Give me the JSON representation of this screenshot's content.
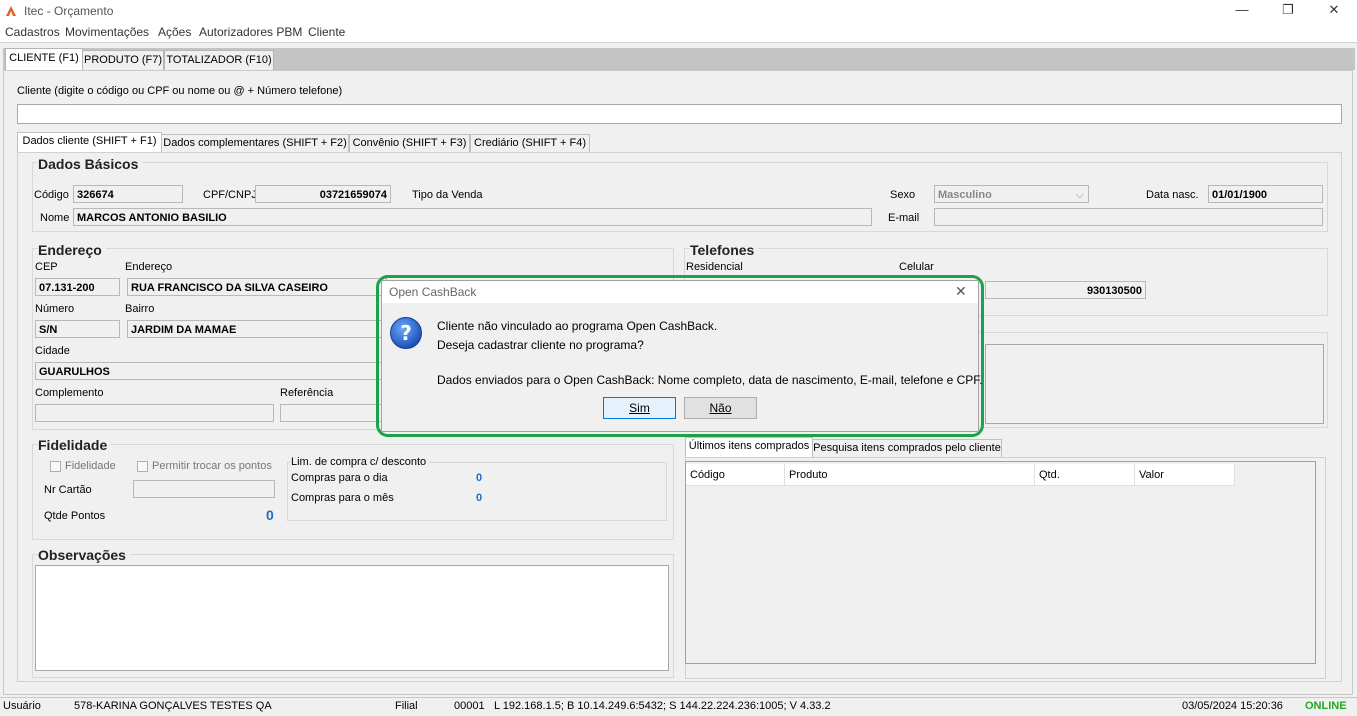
{
  "window": {
    "title": "Itec - Orçamento",
    "minimize": "—",
    "maximize": "❐",
    "close": "✕"
  },
  "menu": [
    "Cadastros",
    "Movimentações",
    "Ações",
    "Autorizadores PBM",
    "Cliente"
  ],
  "main_tabs": [
    "CLIENTE (F1)",
    "PRODUTO (F7)",
    "TOTALIZADOR (F10)"
  ],
  "client_search": {
    "label": "Cliente (digite o código ou CPF ou nome ou @ + Número telefone)",
    "value": ""
  },
  "sub_tabs": [
    "Dados cliente (SHIFT + F1)",
    "Dados complementares (SHIFT + F2)",
    "Convênio (SHIFT + F3)",
    "Crediário (SHIFT + F4)"
  ],
  "basic": {
    "title": "Dados Básicos",
    "codigo_label": "Código",
    "codigo": "326674",
    "cpf_label": "CPF/CNPJ",
    "cpf": "03721659074",
    "tipo_venda_label": "Tipo da Venda",
    "sexo_label": "Sexo",
    "sexo": "Masculino",
    "nasc_label": "Data nasc.",
    "nasc": "01/01/1900",
    "nome_label": "Nome",
    "nome": "MARCOS ANTONIO BASILIO",
    "email_label": "E-mail",
    "email": ""
  },
  "address": {
    "title": "Endereço",
    "cep_label": "CEP",
    "cep": "07.131-200",
    "endereco_label": "Endereço",
    "endereco": "RUA FRANCISCO DA SILVA CASEIRO",
    "numero_label": "Número",
    "numero": "S/N",
    "bairro_label": "Bairro",
    "bairro": "JARDIM DA MAMAE",
    "cidade_label": "Cidade",
    "cidade": "GUARULHOS",
    "complemento_label": "Complemento",
    "complemento": "",
    "referencia_label": "Referência",
    "referencia": ""
  },
  "phones": {
    "title": "Telefones",
    "residencial_label": "Residencial",
    "celular_label": "Celular",
    "celular": "930130500"
  },
  "loyalty": {
    "title": "Fidelidade",
    "fidelidade_label": "Fidelidade",
    "trocar_label": "Permitir trocar os pontos",
    "cartao_label": "Nr Cartão",
    "pontos_label": "Qtde Pontos",
    "pontos": "0",
    "limit_title": "Lim. de compra c/ desconto",
    "dia_label": "Compras para o dia",
    "dia": "0",
    "mes_label": "Compras para o mês",
    "mes": "0"
  },
  "obs": {
    "title": "Observações"
  },
  "purchases": {
    "tabs": [
      "Últimos itens comprados",
      "Pesquisa itens comprados pelo cliente"
    ],
    "columns": [
      "Código",
      "Produto",
      "Qtd.",
      "Valor"
    ]
  },
  "dialog": {
    "title": "Open CashBack",
    "close": "✕",
    "line1": "Cliente não vinculado ao programa Open CashBack.",
    "line2": "Deseja cadastrar cliente no programa?",
    "line3": "Dados enviados para o Open CashBack: Nome completo, data de nascimento, E-mail, telefone e CPF.",
    "yes": "Sim",
    "no": "Não"
  },
  "status": {
    "user_label": "Usuário",
    "user": "578-KARINA GONÇALVES TESTES QA",
    "filial_label": "Filial",
    "filial": "00001",
    "conn": "L 192.168.1.5; B 10.14.249.6:5432; S 144.22.224.236:1005; V 4.33.2",
    "datetime": "03/05/2024 15:20:36",
    "online": "ONLINE"
  },
  "colors": {
    "accent_green": "#1aa34a",
    "blue_value": "#1a6fc4",
    "online": "#22aa22"
  }
}
